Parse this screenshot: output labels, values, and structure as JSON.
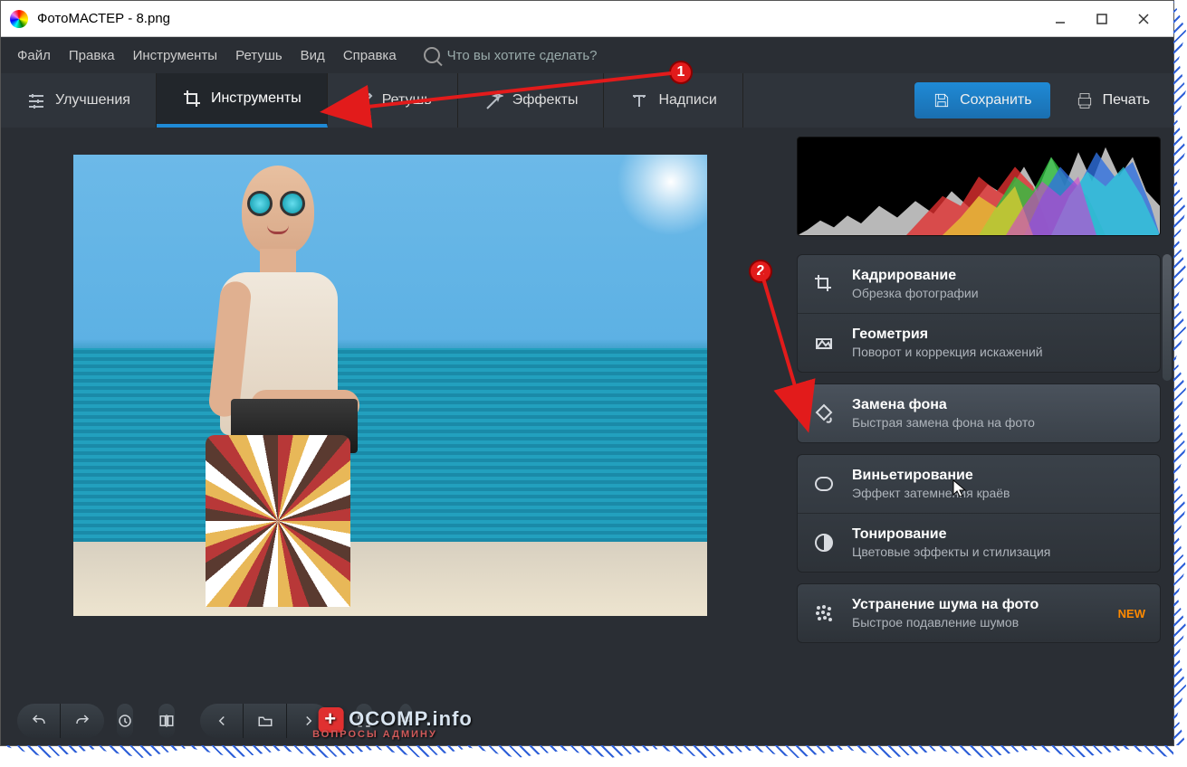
{
  "window": {
    "title": "ФотоМАСТЕР - 8.png"
  },
  "menu": {
    "file": "Файл",
    "edit": "Правка",
    "tools": "Инструменты",
    "retouch": "Ретушь",
    "view": "Вид",
    "help": "Справка",
    "search_placeholder": "Что вы хотите сделать?"
  },
  "tabs": {
    "enhance": "Улучшения",
    "tools": "Инструменты",
    "retouch": "Ретушь",
    "effects": "Эффекты",
    "captions": "Надписи"
  },
  "actions": {
    "save": "Сохранить",
    "print": "Печать"
  },
  "tools_panel": {
    "crop": {
      "title": "Кадрирование",
      "sub": "Обрезка фотографии"
    },
    "geometry": {
      "title": "Геометрия",
      "sub": "Поворот и коррекция искажений"
    },
    "replace_bg": {
      "title": "Замена фона",
      "sub": "Быстрая замена фона на фото"
    },
    "vignette": {
      "title": "Виньетирование",
      "sub": "Эффект затемнения краёв"
    },
    "toning": {
      "title": "Тонирование",
      "sub": "Цветовые эффекты и стилизация"
    },
    "denoise": {
      "title": "Устранение шума на фото",
      "sub": "Быстрое подавление шумов",
      "badge": "NEW"
    }
  },
  "annotations": {
    "step1": "1",
    "step2": "2"
  },
  "watermark": {
    "main": "OCOMP.info",
    "sub": "ВОПРОСЫ АДМИНУ"
  }
}
